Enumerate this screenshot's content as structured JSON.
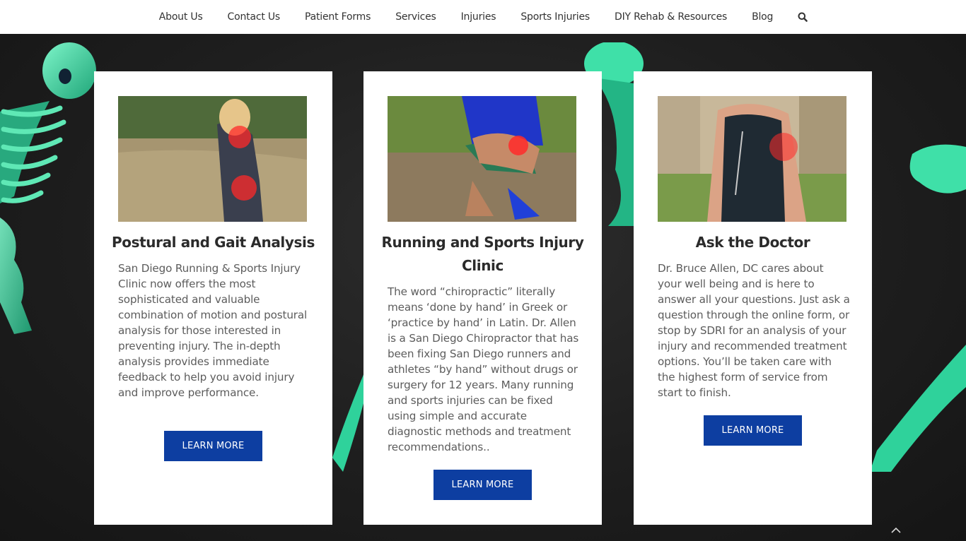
{
  "nav": {
    "items": [
      "About Us",
      "Contact Us",
      "Patient Forms",
      "Services",
      "Injuries",
      "Sports Injuries",
      "DIY Rehab & Resources",
      "Blog"
    ],
    "search_icon": "search-icon"
  },
  "cards": [
    {
      "title": "Postural and Gait Analysis",
      "text": "San Diego Running & Sports Injury Clinic now offers the most sophisticated and valuable combination of motion and postural analysis for those interested in preventing injury. The in-depth analysis provides immediate feedback to help you avoid injury and improve performance.",
      "button": "LEARN MORE"
    },
    {
      "title": "Running and Sports Injury Clinic",
      "text": "The word “chiropractic” literally means ‘done by hand’ in Greek or ‘practice by hand’ in Latin. Dr. Allen is a San Diego Chiropractor that has been fixing San Diego runners and athletes “by hand” without drugs or surgery for 12 years. Many running and sports injuries can be fixed using simple and accurate diagnostic methods and treatment recommendations..",
      "button": "LEARN MORE"
    },
    {
      "title": "Ask the Doctor",
      "text": "Dr. Bruce Allen, DC cares about your well being and is here to answer all your questions. Just ask a question through the online form, or stop by SDRI for an analysis of your injury and recommended treatment options. You’ll be taken care with the highest form of service from start to finish.",
      "button": "LEARN MORE"
    }
  ],
  "colors": {
    "button": "#0d3ea1",
    "skeleton": "#3fe0a8",
    "pain_marker": "#ff2a2a"
  },
  "scroll_top_icon": "chevron-up-icon"
}
